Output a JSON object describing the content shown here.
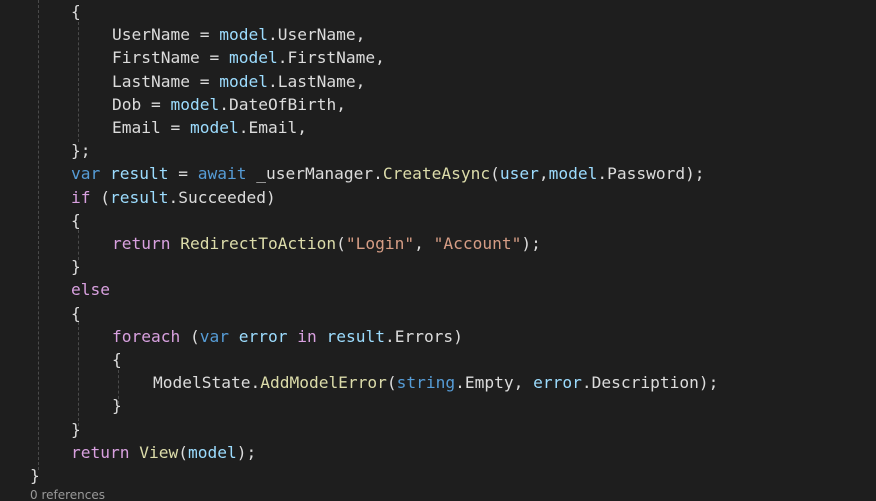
{
  "colors": {
    "background": "#1e1e1e",
    "plain": "#dcdcdc",
    "keyword": "#569cd6",
    "control_keyword": "#d8a0df",
    "variable": "#9cdcfe",
    "type": "#4ec9b0",
    "method": "#dcdcaa",
    "string": "#d69d85",
    "punctuation": "#b4b4b4",
    "codelens": "#999999"
  },
  "code_lines": [
    [
      {
        "t": "{",
        "c": "plain"
      }
    ],
    [
      {
        "t": "UserName",
        "c": "plain"
      },
      {
        "t": " = ",
        "c": "plain"
      },
      {
        "t": "model",
        "c": "var"
      },
      {
        "t": ".",
        "c": "plain"
      },
      {
        "t": "UserName",
        "c": "plain"
      },
      {
        "t": ",",
        "c": "plain"
      }
    ],
    [
      {
        "t": "FirstName",
        "c": "plain"
      },
      {
        "t": " = ",
        "c": "plain"
      },
      {
        "t": "model",
        "c": "var"
      },
      {
        "t": ".",
        "c": "plain"
      },
      {
        "t": "FirstName",
        "c": "plain"
      },
      {
        "t": ",",
        "c": "plain"
      }
    ],
    [
      {
        "t": "LastName",
        "c": "plain"
      },
      {
        "t": " = ",
        "c": "plain"
      },
      {
        "t": "model",
        "c": "var"
      },
      {
        "t": ".",
        "c": "plain"
      },
      {
        "t": "LastName",
        "c": "plain"
      },
      {
        "t": ",",
        "c": "plain"
      }
    ],
    [
      {
        "t": "Dob",
        "c": "plain"
      },
      {
        "t": " = ",
        "c": "plain"
      },
      {
        "t": "model",
        "c": "var"
      },
      {
        "t": ".",
        "c": "plain"
      },
      {
        "t": "DateOfBirth",
        "c": "plain"
      },
      {
        "t": ",",
        "c": "plain"
      }
    ],
    [
      {
        "t": "Email",
        "c": "plain"
      },
      {
        "t": " = ",
        "c": "plain"
      },
      {
        "t": "model",
        "c": "var"
      },
      {
        "t": ".",
        "c": "plain"
      },
      {
        "t": "Email",
        "c": "plain"
      },
      {
        "t": ",",
        "c": "plain"
      }
    ],
    [
      {
        "t": "};",
        "c": "plain"
      }
    ],
    [
      {
        "t": "var",
        "c": "kw"
      },
      {
        "t": " ",
        "c": "plain"
      },
      {
        "t": "result",
        "c": "var"
      },
      {
        "t": " = ",
        "c": "plain"
      },
      {
        "t": "await",
        "c": "kw"
      },
      {
        "t": " _userManager",
        "c": "plain"
      },
      {
        "t": ".",
        "c": "plain"
      },
      {
        "t": "CreateAsync",
        "c": "meth"
      },
      {
        "t": "(",
        "c": "plain"
      },
      {
        "t": "user",
        "c": "var"
      },
      {
        "t": ",",
        "c": "plain"
      },
      {
        "t": "model",
        "c": "var"
      },
      {
        "t": ".",
        "c": "plain"
      },
      {
        "t": "Password",
        "c": "plain"
      },
      {
        "t": ");",
        "c": "plain"
      }
    ],
    [
      {
        "t": "if",
        "c": "ctl"
      },
      {
        "t": " (",
        "c": "plain"
      },
      {
        "t": "result",
        "c": "var"
      },
      {
        "t": ".",
        "c": "plain"
      },
      {
        "t": "Succeeded",
        "c": "plain"
      },
      {
        "t": ")",
        "c": "plain"
      }
    ],
    [
      {
        "t": "{",
        "c": "plain"
      }
    ],
    [
      {
        "t": "return",
        "c": "ctl"
      },
      {
        "t": " ",
        "c": "plain"
      },
      {
        "t": "RedirectToAction",
        "c": "meth"
      },
      {
        "t": "(",
        "c": "plain"
      },
      {
        "t": "\"Login\"",
        "c": "str"
      },
      {
        "t": ", ",
        "c": "plain"
      },
      {
        "t": "\"Account\"",
        "c": "str"
      },
      {
        "t": ");",
        "c": "plain"
      }
    ],
    [
      {
        "t": "}",
        "c": "plain"
      }
    ],
    [
      {
        "t": "else",
        "c": "ctl"
      }
    ],
    [
      {
        "t": "{",
        "c": "plain"
      }
    ],
    [
      {
        "t": "foreach",
        "c": "ctl"
      },
      {
        "t": " (",
        "c": "plain"
      },
      {
        "t": "var",
        "c": "kw"
      },
      {
        "t": " ",
        "c": "plain"
      },
      {
        "t": "error",
        "c": "var"
      },
      {
        "t": " ",
        "c": "plain"
      },
      {
        "t": "in",
        "c": "ctl"
      },
      {
        "t": " ",
        "c": "plain"
      },
      {
        "t": "result",
        "c": "var"
      },
      {
        "t": ".",
        "c": "plain"
      },
      {
        "t": "Errors",
        "c": "plain"
      },
      {
        "t": ")",
        "c": "plain"
      }
    ],
    [
      {
        "t": "{",
        "c": "plain"
      }
    ],
    [
      {
        "t": "ModelState",
        "c": "plain"
      },
      {
        "t": ".",
        "c": "plain"
      },
      {
        "t": "AddModelError",
        "c": "meth"
      },
      {
        "t": "(",
        "c": "plain"
      },
      {
        "t": "string",
        "c": "kw"
      },
      {
        "t": ".",
        "c": "plain"
      },
      {
        "t": "Empty",
        "c": "plain"
      },
      {
        "t": ", ",
        "c": "plain"
      },
      {
        "t": "error",
        "c": "var"
      },
      {
        "t": ".",
        "c": "plain"
      },
      {
        "t": "Description",
        "c": "plain"
      },
      {
        "t": ");",
        "c": "plain"
      }
    ],
    [
      {
        "t": "}",
        "c": "plain"
      }
    ],
    [
      {
        "t": "}",
        "c": "plain"
      }
    ],
    [
      {
        "t": "return",
        "c": "ctl"
      },
      {
        "t": " ",
        "c": "plain"
      },
      {
        "t": "View",
        "c": "meth"
      },
      {
        "t": "(",
        "c": "plain"
      },
      {
        "t": "model",
        "c": "var"
      },
      {
        "t": ");",
        "c": "plain"
      }
    ],
    [
      {
        "t": "}",
        "c": "plain"
      }
    ]
  ],
  "codelens": {
    "references_text": "0 references"
  }
}
